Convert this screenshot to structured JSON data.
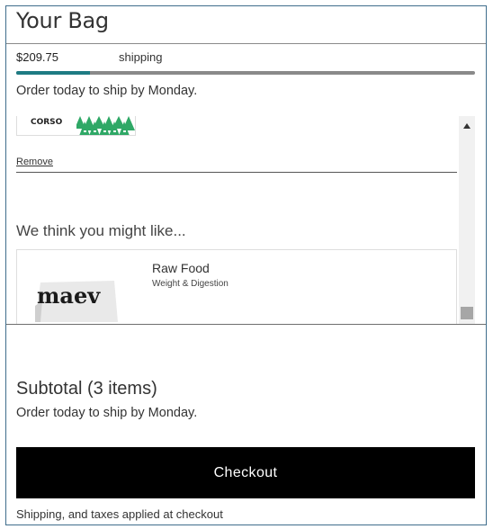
{
  "header": {
    "title": "Your Bag"
  },
  "shipping_bar": {
    "amount": "$209.75",
    "label": "shipping",
    "progress": 0.16,
    "accent_color": "#1e7b83"
  },
  "ship_note": "Order today to ship by Monday.",
  "cart_item": {
    "brand": "CORSO",
    "remove_label": "Remove"
  },
  "recommendations": {
    "heading": "We think you might like...",
    "items": [
      {
        "name": "Raw Food",
        "subtitle": "Weight & Digestion",
        "brand": "maev"
      }
    ]
  },
  "summary": {
    "subtotal": "Subtotal (3 items)",
    "ship_note": "Order today to ship by Monday."
  },
  "checkout": {
    "label": "Checkout"
  },
  "footnote": "Shipping, and taxes applied at checkout",
  "icons": {
    "scroll_up": "scroll-up-arrow-icon"
  }
}
